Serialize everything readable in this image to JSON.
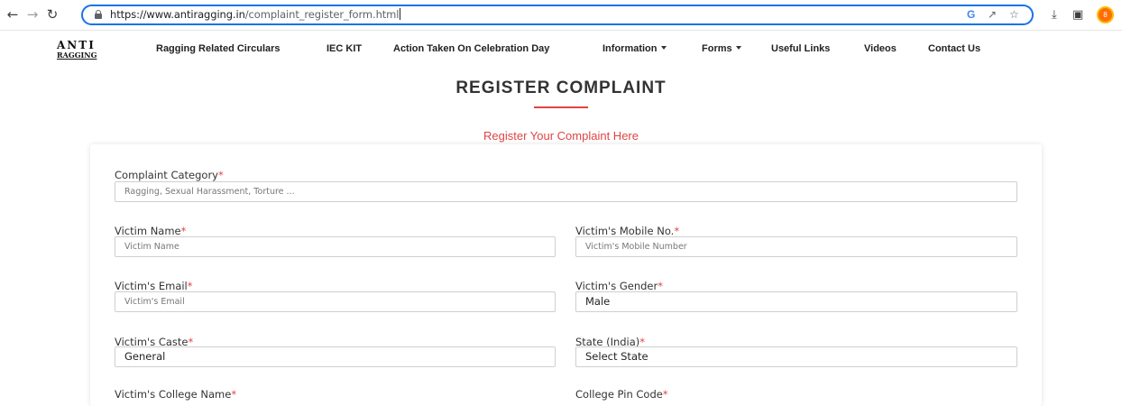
{
  "browser": {
    "url_host": "https://www.antiragging.in",
    "url_path": "/complaint_register_form.html",
    "profile_badge": "8"
  },
  "site": {
    "logo_top": "ANTI",
    "logo_bottom": "RAGGING",
    "nav": [
      {
        "label": "Ragging Related Circulars",
        "dropdown": false
      },
      {
        "label": "IEC KIT",
        "dropdown": false
      },
      {
        "label": "Action Taken On Celebration Day",
        "dropdown": false
      },
      {
        "label": "Information",
        "dropdown": true
      },
      {
        "label": "Forms",
        "dropdown": true
      },
      {
        "label": "Useful Links",
        "dropdown": false
      },
      {
        "label": "Videos",
        "dropdown": false
      },
      {
        "label": "Contact Us",
        "dropdown": false
      }
    ]
  },
  "page": {
    "title": "REGISTER COMPLAINT",
    "subtitle": "Register Your Complaint Here"
  },
  "form": {
    "required_mark": "*",
    "complaint_category": {
      "label": "Complaint Category",
      "placeholder": "Ragging, Sexual Harassment, Torture ..."
    },
    "victim_name": {
      "label": "Victim Name",
      "placeholder": "Victim Name"
    },
    "victim_mobile": {
      "label": "Victim's Mobile No.",
      "placeholder": "Victim's Mobile Number"
    },
    "victim_email": {
      "label": "Victim's Email",
      "placeholder": "Victim's Email"
    },
    "victim_gender": {
      "label": "Victim's Gender",
      "value": "Male"
    },
    "victim_caste": {
      "label": "Victim's Caste",
      "value": "General"
    },
    "state": {
      "label": "State (India)",
      "value": "Select State"
    },
    "college_name": {
      "label": "Victim's College Name"
    },
    "college_pin": {
      "label": "College Pin Code"
    }
  },
  "colors": {
    "accent_red": "#e14444",
    "focus_blue": "#1a73e8"
  }
}
